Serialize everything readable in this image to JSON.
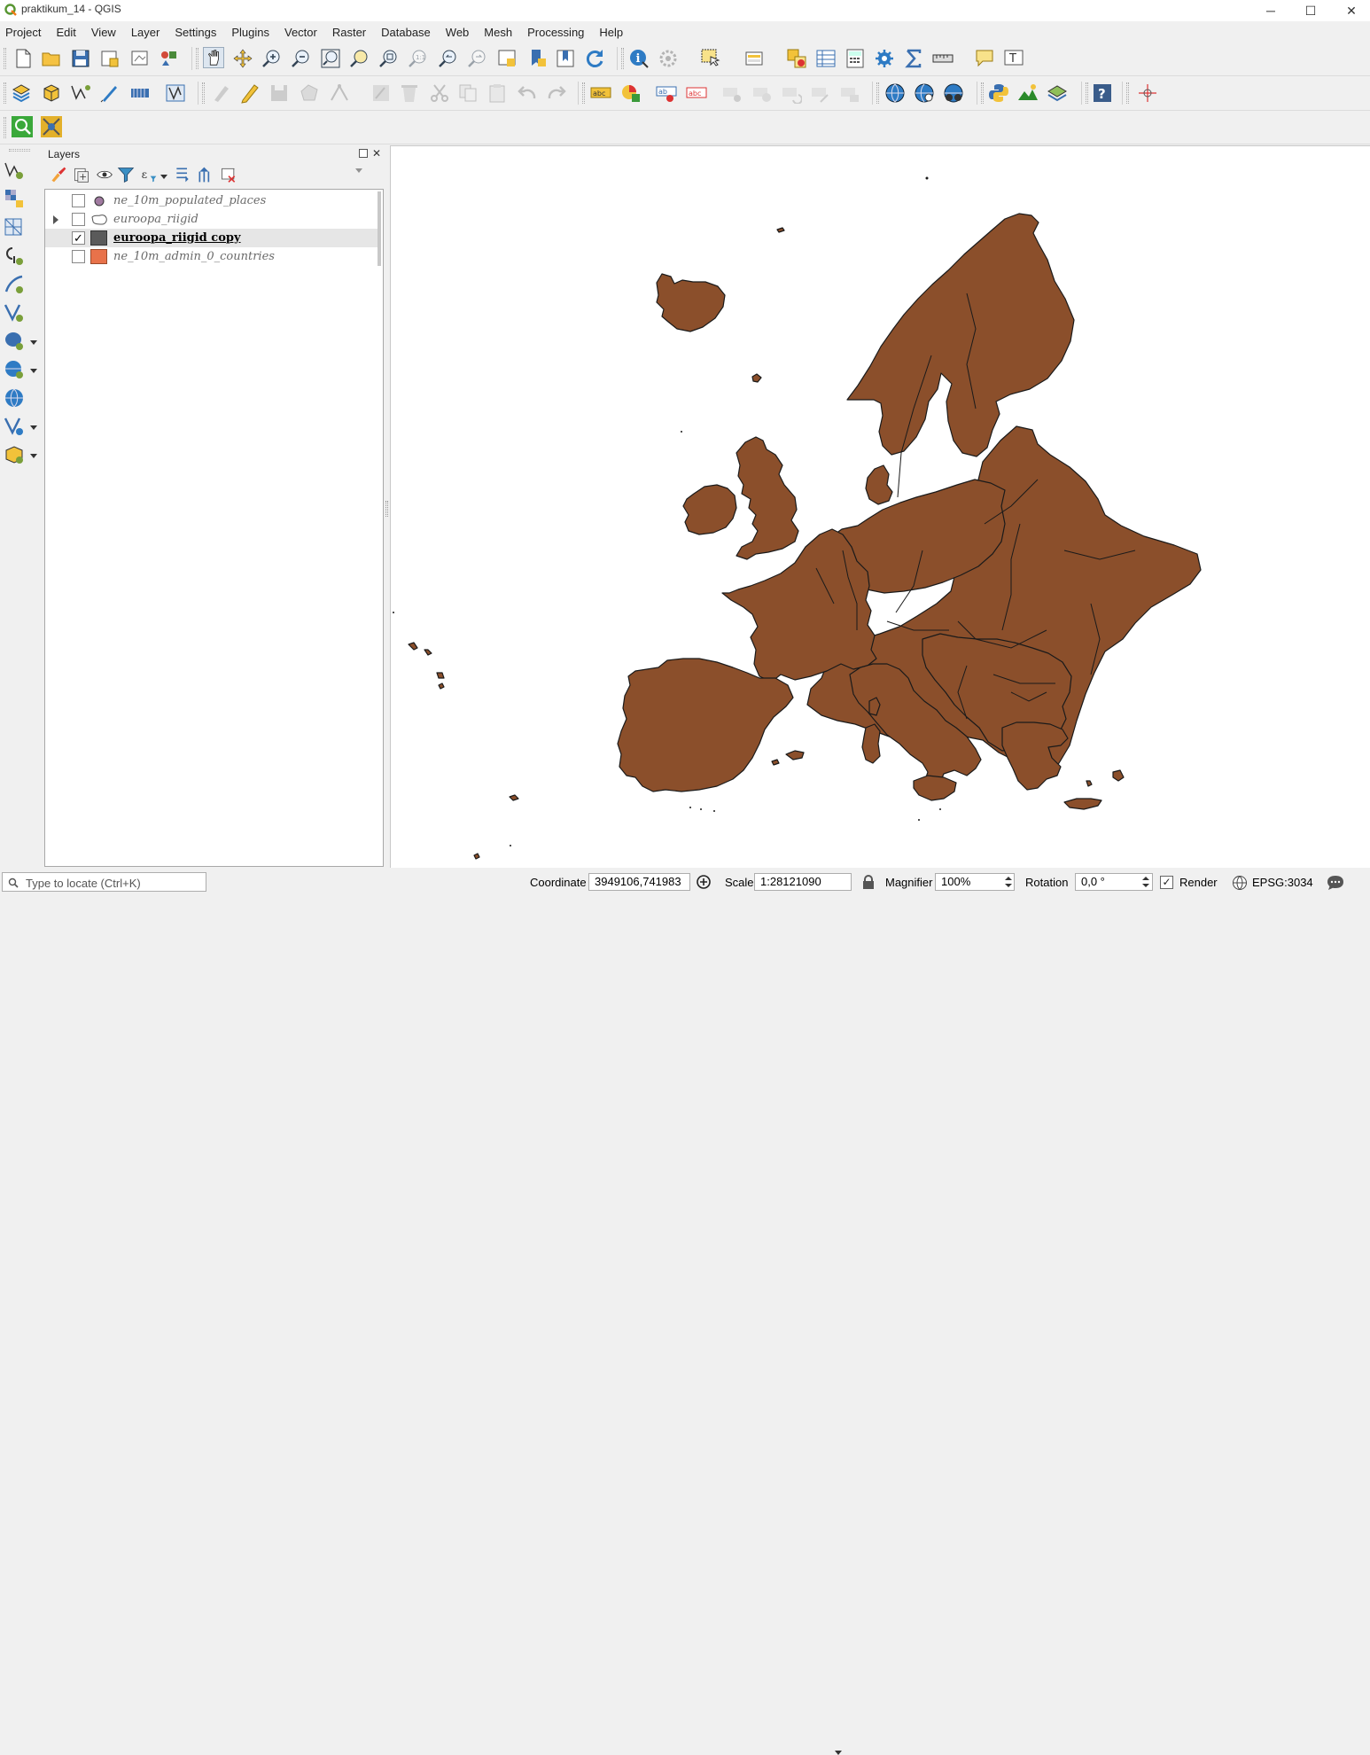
{
  "window": {
    "title": "praktikum_14 - QGIS",
    "minimize": "─",
    "maximize": "☐",
    "close": "✕"
  },
  "menu": [
    "Project",
    "Edit",
    "View",
    "Layer",
    "Settings",
    "Plugins",
    "Vector",
    "Raster",
    "Database",
    "Web",
    "Mesh",
    "Processing",
    "Help"
  ],
  "layers_panel": {
    "title": "Layers",
    "layers": [
      {
        "name": "ne_10m_populated_places",
        "checked": false,
        "symbol": "point",
        "color": "#a07aa0",
        "active": false
      },
      {
        "name": "euroopa_riigid",
        "checked": false,
        "symbol": "polygon-outline",
        "color": "#ffffff",
        "active": false,
        "expandable": true
      },
      {
        "name": "euroopa_riigid copy",
        "checked": true,
        "symbol": "fill",
        "color": "#5a5a5a",
        "active": true
      },
      {
        "name": "ne_10m_admin_0_countries",
        "checked": false,
        "symbol": "fill",
        "color": "#e8724a",
        "active": false
      }
    ]
  },
  "map": {
    "fill_color": "#8b4f2b",
    "outline_color": "#1a1a1a",
    "background": "#ffffff"
  },
  "statusbar": {
    "locator_placeholder": "Type to locate (Ctrl+K)",
    "coordinate_label": "Coordinate",
    "coordinate_value": "3949106,741983",
    "scale_label": "Scale",
    "scale_value": "1:28121090",
    "magnifier_label": "Magnifier",
    "magnifier_value": "100%",
    "rotation_label": "Rotation",
    "rotation_value": "0,0 °",
    "render_label": "Render",
    "render_checked": true,
    "crs": "EPSG:3034"
  }
}
